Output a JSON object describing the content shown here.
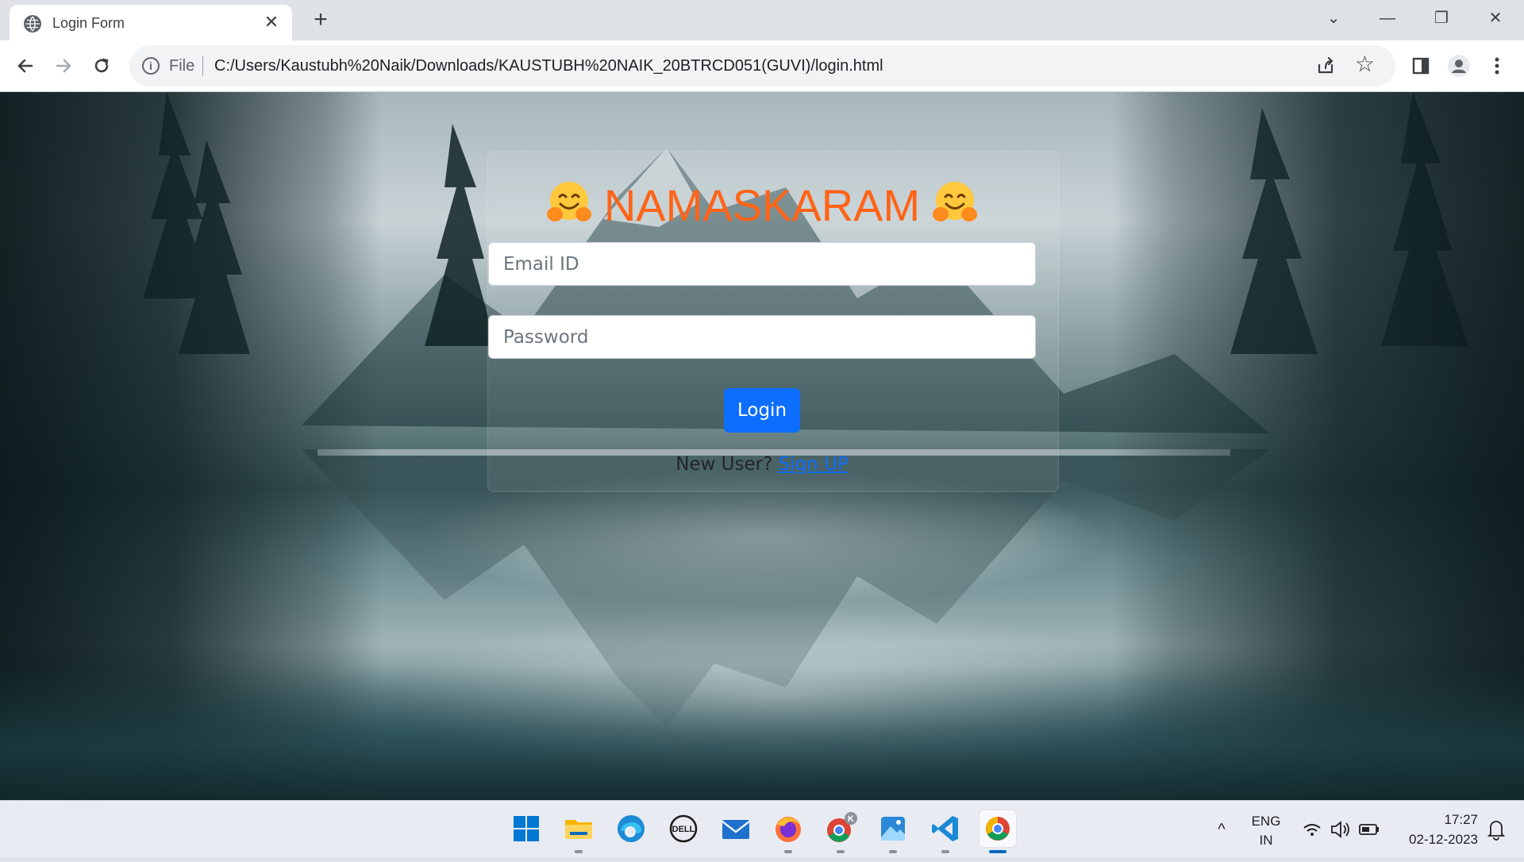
{
  "browser": {
    "tab_title": "Login Form",
    "tab_close": "✕",
    "new_tab": "+",
    "scheme_label": "File",
    "url": "C:/Users/Kaustubh%20Naik/Downloads/KAUSTUBH%20NAIK_20BTRCD051(GUVI)/login.html",
    "window_controls": {
      "tab_search": "⌄",
      "minimize": "—",
      "restore": "❐",
      "close": "✕"
    }
  },
  "page": {
    "headline": "NAMASKARAM",
    "email_placeholder": "Email ID",
    "password_placeholder": "Password",
    "login_label": "Login",
    "new_user_text": "New User?",
    "signup_link": "Sign UP",
    "heading_color": "#ff6418",
    "button_color": "#0d6efd"
  },
  "taskbar": {
    "apps": [
      "start-icon",
      "file-explorer-icon",
      "edge-icon",
      "dell-icon",
      "mail-icon",
      "firefox-icon",
      "chrome-profile-icon",
      "photos-icon",
      "vscode-icon",
      "chrome-icon"
    ],
    "chrome_profile_badge": "K",
    "tray_up": "^",
    "lang_top": "ENG",
    "lang_bottom": "IN",
    "time": "17:27",
    "date": "02-12-2023"
  }
}
